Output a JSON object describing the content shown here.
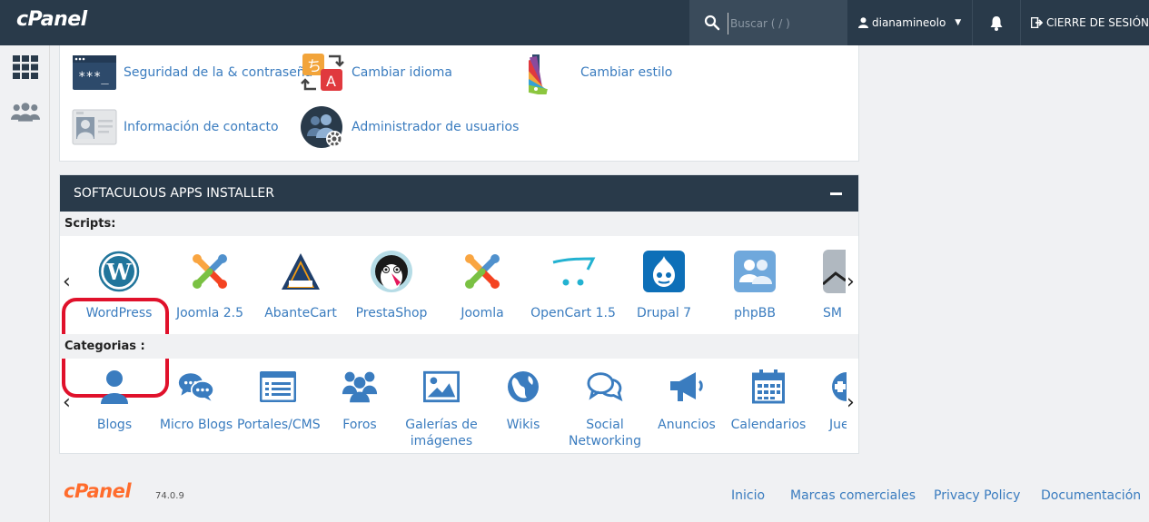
{
  "topbar": {
    "logo": "cPanel",
    "search_placeholder": "Buscar ( / )",
    "username": "dianamineolo",
    "logout": "CIERRE DE SESIÓN"
  },
  "preferences": [
    {
      "label": "Seguridad de la & contraseña",
      "icon": "password-icon"
    },
    {
      "label": "Cambiar idioma",
      "icon": "language-icon"
    },
    {
      "label": "Cambiar estilo",
      "icon": "style-icon"
    },
    {
      "label": "Información de contacto",
      "icon": "contact-card-icon"
    },
    {
      "label": "Administrador de usuarios",
      "icon": "user-manager-icon"
    }
  ],
  "softaculous": {
    "title": "SOFTACULOUS APPS INSTALLER",
    "scripts_label": "Scripts:",
    "categories_label": "Categorias :",
    "scripts": [
      "WordPress",
      "Joomla 2.5",
      "AbanteCart",
      "PrestaShop",
      "Joomla",
      "OpenCart 1.5",
      "Drupal 7",
      "phpBB",
      "SM"
    ],
    "categories": [
      "Blogs",
      "Micro Blogs",
      "Portales/CMS",
      "Foros",
      "Galerías de imágenes",
      "Wikis",
      "Social Networking",
      "Anuncios",
      "Calendarios",
      "Jue"
    ]
  },
  "footer": {
    "logo": "cPanel",
    "version": "74.0.9",
    "links": [
      "Inicio",
      "Marcas comerciales",
      "Privacy Policy",
      "Documentación"
    ]
  },
  "colors": {
    "topbar": "#293a4a",
    "link": "#3a7cbf",
    "highlight": "#e0112b",
    "brand_orange": "#ff6c2c"
  }
}
